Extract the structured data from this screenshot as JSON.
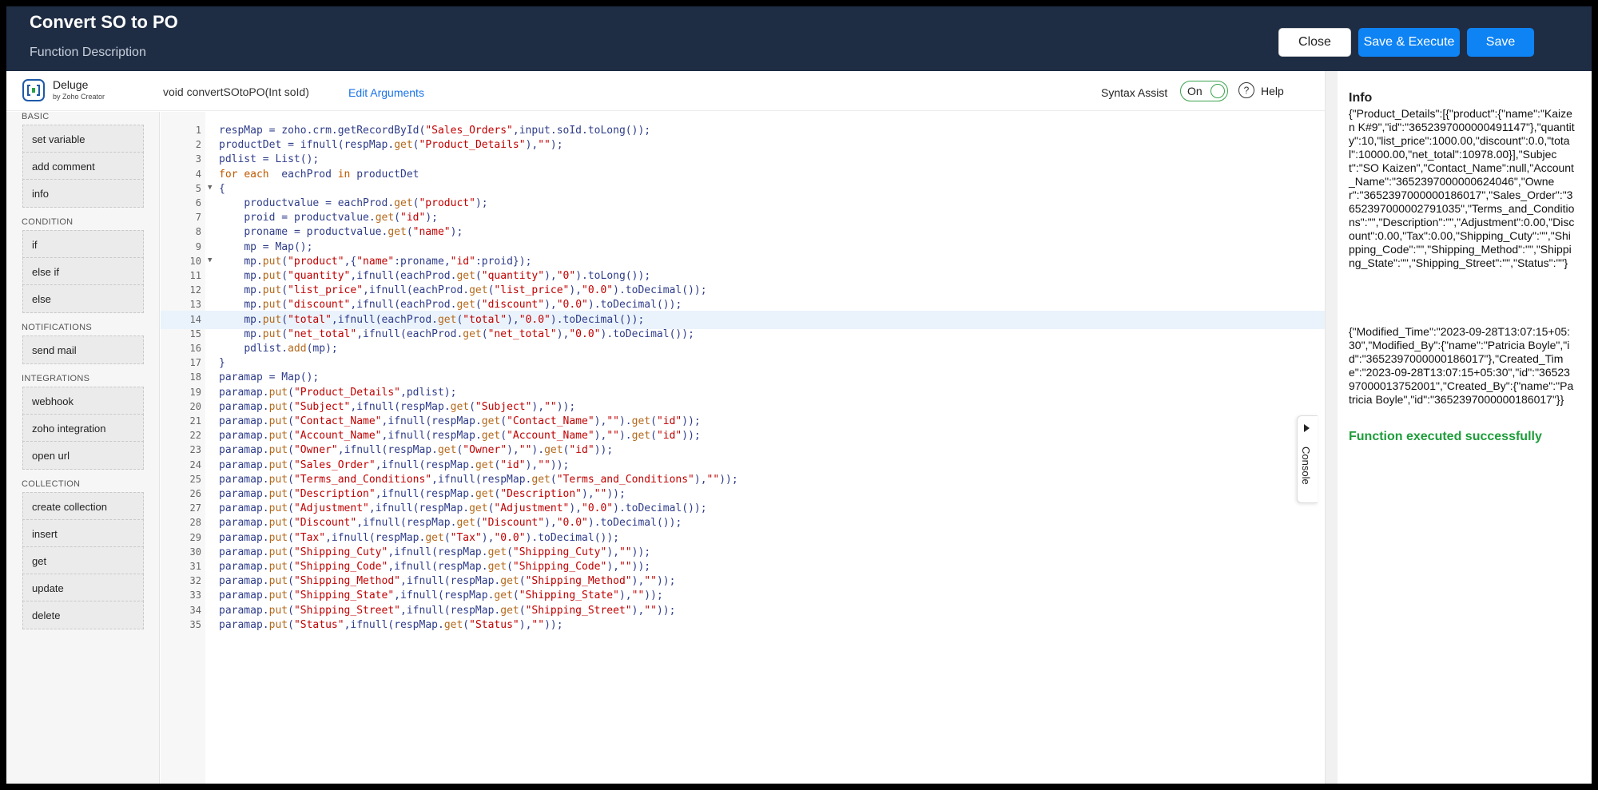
{
  "header": {
    "title": "Convert SO to PO",
    "subtitle": "Function Description",
    "close_label": "Close",
    "save_execute_label": "Save & Execute",
    "save_label": "Save"
  },
  "toolbar": {
    "brand_name": "Deluge",
    "brand_sub": "by Zoho Creator",
    "function_signature": "void  convertSOtoPO(Int soId)",
    "edit_arguments_label": "Edit Arguments",
    "syntax_assist_label": "Syntax Assist",
    "syntax_assist_state": "On",
    "help_label": "Help",
    "help_icon_glyph": "?"
  },
  "palette": {
    "sections": [
      {
        "heading": "BASIC",
        "items": [
          "set variable",
          "add comment",
          "info"
        ]
      },
      {
        "heading": "CONDITION",
        "items": [
          "if",
          "else if",
          "else"
        ]
      },
      {
        "heading": "NOTIFICATIONS",
        "items": [
          "send mail"
        ]
      },
      {
        "heading": "INTEGRATIONS",
        "items": [
          "webhook",
          "zoho integration",
          "open url"
        ]
      },
      {
        "heading": "COLLECTION",
        "items": [
          "create collection",
          "insert",
          "get",
          "update",
          "delete"
        ]
      }
    ]
  },
  "editor": {
    "active_line": 14,
    "lines": [
      {
        "n": "1",
        "text": "respMap = zoho.crm.getRecordById(\"Sales_Orders\",input.soId.toLong());"
      },
      {
        "n": "2",
        "text": "productDet = ifnull(respMap.get(\"Product_Details\"),\"\");"
      },
      {
        "n": "3",
        "text": "pdlist = List();"
      },
      {
        "n": "4",
        "text": "for each  eachProd in productDet"
      },
      {
        "n": "5",
        "text": "{",
        "fold": true
      },
      {
        "n": "6",
        "text": "    productvalue = eachProd.get(\"product\");"
      },
      {
        "n": "7",
        "text": "    proid = productvalue.get(\"id\");"
      },
      {
        "n": "8",
        "text": "    proname = productvalue.get(\"name\");"
      },
      {
        "n": "9",
        "text": "    mp = Map();"
      },
      {
        "n": "10",
        "text": "    mp.put(\"product\",{\"name\":proname,\"id\":proid});",
        "fold": true
      },
      {
        "n": "11",
        "text": "    mp.put(\"quantity\",ifnull(eachProd.get(\"quantity\"),\"0\").toLong());"
      },
      {
        "n": "12",
        "text": "    mp.put(\"list_price\",ifnull(eachProd.get(\"list_price\"),\"0.0\").toDecimal());"
      },
      {
        "n": "13",
        "text": "    mp.put(\"discount\",ifnull(eachProd.get(\"discount\"),\"0.0\").toDecimal());"
      },
      {
        "n": "14",
        "text": "    mp.put(\"total\",ifnull(eachProd.get(\"total\"),\"0.0\").toDecimal());"
      },
      {
        "n": "15",
        "text": "    mp.put(\"net_total\",ifnull(eachProd.get(\"net_total\"),\"0.0\").toDecimal());"
      },
      {
        "n": "16",
        "text": "    pdlist.add(mp);"
      },
      {
        "n": "17",
        "text": "}"
      },
      {
        "n": "18",
        "text": "paramap = Map();"
      },
      {
        "n": "19",
        "text": "paramap.put(\"Product_Details\",pdlist);"
      },
      {
        "n": "20",
        "text": "paramap.put(\"Subject\",ifnull(respMap.get(\"Subject\"),\"\"));"
      },
      {
        "n": "21",
        "text": "paramap.put(\"Contact_Name\",ifnull(respMap.get(\"Contact_Name\"),\"\").get(\"id\"));"
      },
      {
        "n": "22",
        "text": "paramap.put(\"Account_Name\",ifnull(respMap.get(\"Account_Name\"),\"\").get(\"id\"));"
      },
      {
        "n": "23",
        "text": "paramap.put(\"Owner\",ifnull(respMap.get(\"Owner\"),\"\").get(\"id\"));"
      },
      {
        "n": "24",
        "text": "paramap.put(\"Sales_Order\",ifnull(respMap.get(\"id\"),\"\"));"
      },
      {
        "n": "25",
        "text": "paramap.put(\"Terms_and_Conditions\",ifnull(respMap.get(\"Terms_and_Conditions\"),\"\"));"
      },
      {
        "n": "26",
        "text": "paramap.put(\"Description\",ifnull(respMap.get(\"Description\"),\"\"));"
      },
      {
        "n": "27",
        "text": "paramap.put(\"Adjustment\",ifnull(respMap.get(\"Adjustment\"),\"0.0\").toDecimal());"
      },
      {
        "n": "28",
        "text": "paramap.put(\"Discount\",ifnull(respMap.get(\"Discount\"),\"0.0\").toDecimal());"
      },
      {
        "n": "29",
        "text": "paramap.put(\"Tax\",ifnull(respMap.get(\"Tax\"),\"0.0\").toDecimal());"
      },
      {
        "n": "30",
        "text": "paramap.put(\"Shipping_Cuty\",ifnull(respMap.get(\"Shipping_Cuty\"),\"\"));"
      },
      {
        "n": "31",
        "text": "paramap.put(\"Shipping_Code\",ifnull(respMap.get(\"Shipping_Code\"),\"\"));"
      },
      {
        "n": "32",
        "text": "paramap.put(\"Shipping_Method\",ifnull(respMap.get(\"Shipping_Method\"),\"\"));"
      },
      {
        "n": "33",
        "text": "paramap.put(\"Shipping_State\",ifnull(respMap.get(\"Shipping_State\"),\"\"));"
      },
      {
        "n": "34",
        "text": "paramap.put(\"Shipping_Street\",ifnull(respMap.get(\"Shipping_Street\"),\"\"));"
      },
      {
        "n": "35",
        "text": "paramap.put(\"Status\",ifnull(respMap.get(\"Status\"),\"\"));"
      }
    ]
  },
  "console": {
    "label": "Console"
  },
  "info_panel": {
    "title": "Info",
    "output_1": "{\"Product_Details\":[{\"product\":{\"name\":\"Kaizen K#9\",\"id\":\"3652397000000491147\"},\"quantity\":10,\"list_price\":1000.00,\"discount\":0.0,\"total\":10000.00,\"net_total\":10978.00}],\"Subject\":\"SO Kaizen\",\"Contact_Name\":null,\"Account_Name\":\"3652397000000624046\",\"Owner\":\"3652397000000186017\",\"Sales_Order\":\"3652397000002791035\",\"Terms_and_Conditions\":\"\",\"Description\":\"\",\"Adjustment\":0.00,\"Discount\":0.00,\"Tax\":0.00,\"Shipping_Cuty\":\"\",\"Shipping_Code\":\"\",\"Shipping_Method\":\"\",\"Shipping_State\":\"\",\"Shipping_Street\":\"\",\"Status\":\"\"}",
    "output_2": "{\"Modified_Time\":\"2023-09-28T13:07:15+05:30\",\"Modified_By\":{\"name\":\"Patricia Boyle\",\"id\":\"3652397000000186017\"},\"Created_Time\":\"2023-09-28T13:07:15+05:30\",\"id\":\"3652397000013752001\",\"Created_By\":{\"name\":\"Patricia Boyle\",\"id\":\"3652397000000186017\"}}",
    "status": "Function executed successfully",
    "status_color": "#1e9d3a"
  },
  "colors": {
    "header_bg": "#1f2d44",
    "primary_button": "#0e83f4",
    "toggle_on": "#3aa34d"
  }
}
